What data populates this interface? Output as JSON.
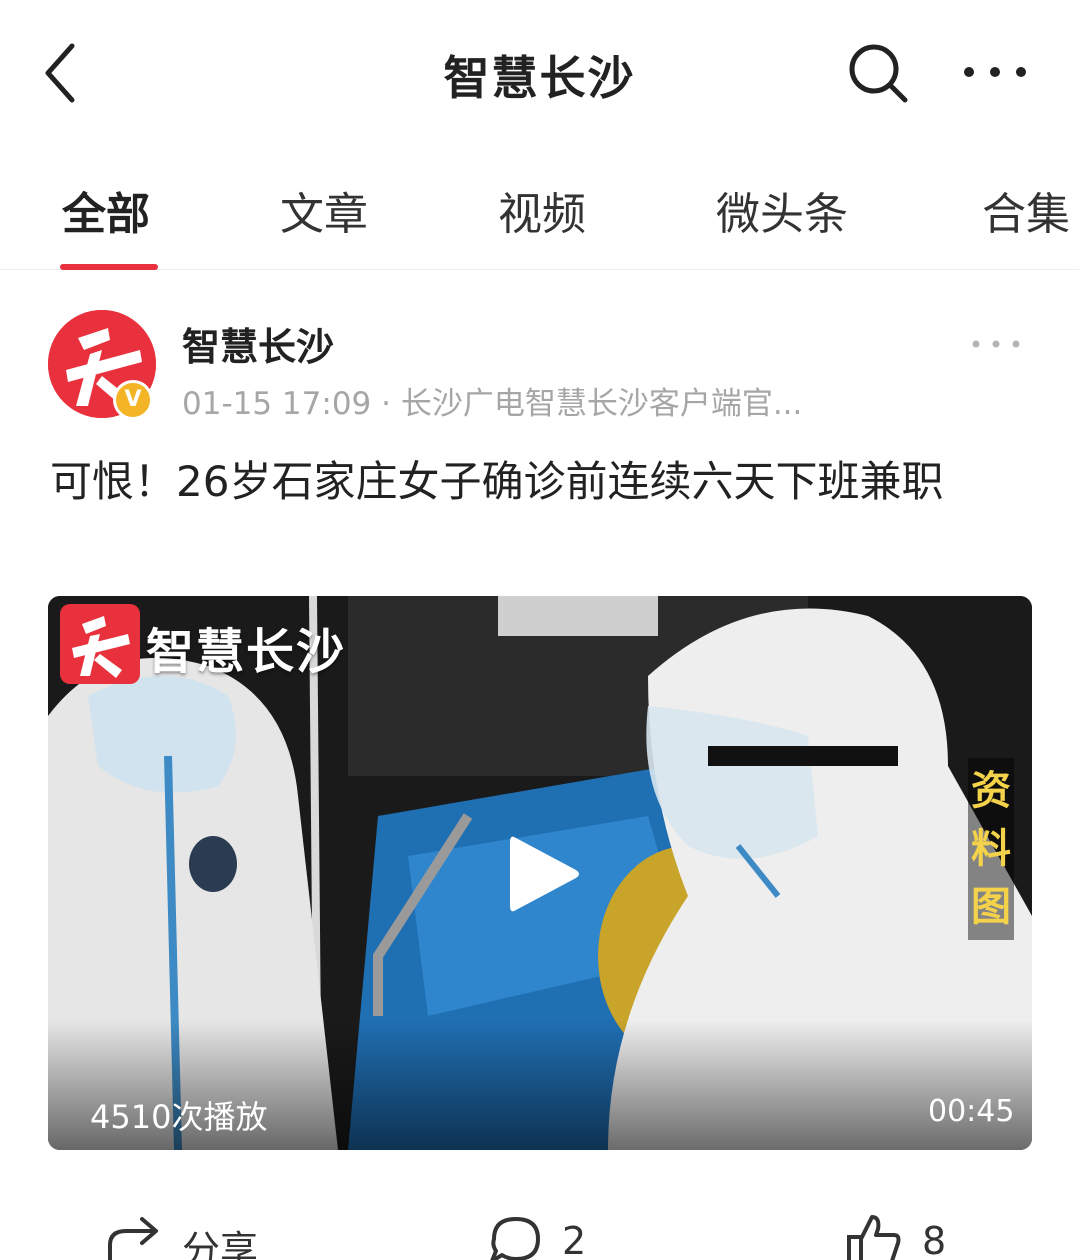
{
  "header": {
    "title": "智慧长沙",
    "back_icon": "chevron-left-icon",
    "search_icon": "search-icon",
    "more_icon": "more-horizontal-icon"
  },
  "tabs": [
    {
      "label": "全部",
      "active": true
    },
    {
      "label": "文章",
      "active": false
    },
    {
      "label": "视频",
      "active": false
    },
    {
      "label": "微头条",
      "active": false
    },
    {
      "label": "合集",
      "active": false
    }
  ],
  "post": {
    "author": "智慧长沙",
    "verified_badge": "V",
    "meta": "01-15 17:09 · 长沙广电智慧长沙客户端官...",
    "title": "可恨！26岁石家庄女子确诊前连续六天下班兼职",
    "video": {
      "brand": "智慧长沙",
      "stamp": "资料图",
      "play_count": "4510次播放",
      "duration": "00:45"
    }
  },
  "actions": {
    "share_label": "分享",
    "comment_count": "2",
    "like_count": "8"
  },
  "colors": {
    "accent": "#e8313c",
    "badge": "#f3b526",
    "meta_text": "#a6a6a6"
  }
}
